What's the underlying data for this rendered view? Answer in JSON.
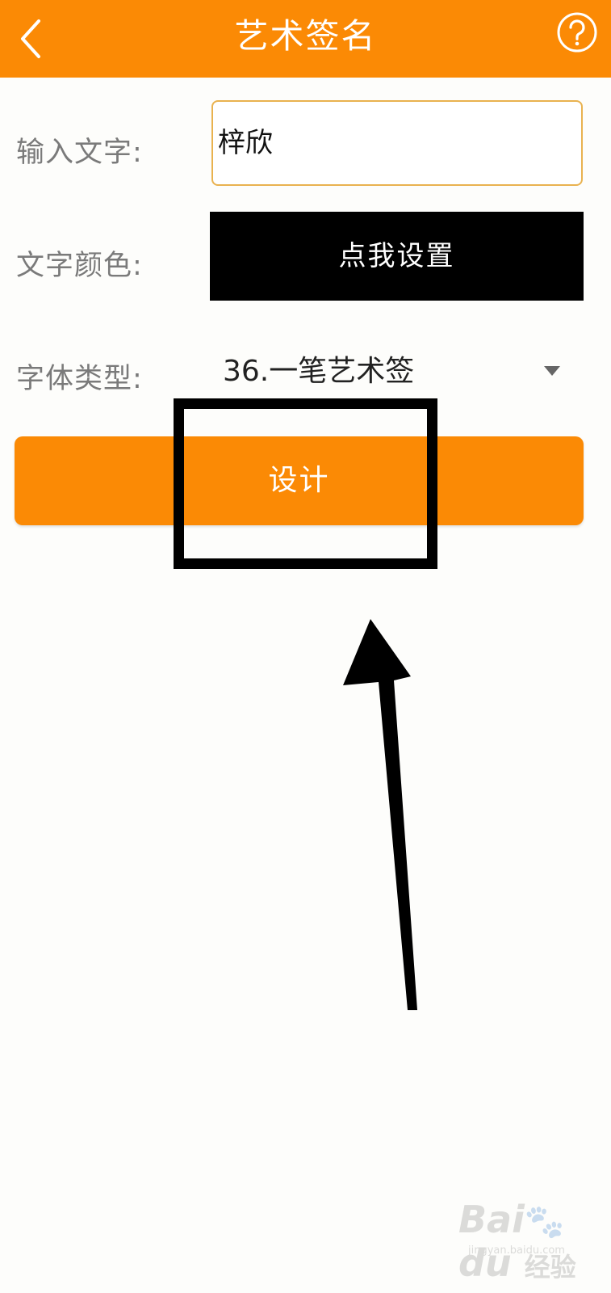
{
  "theme": {
    "accent": "#fb8a05",
    "annotation_color": "#000000"
  },
  "header": {
    "back_icon": "chevron-left-icon",
    "title": "艺术签名",
    "help_icon": "question-circle-icon"
  },
  "form": {
    "text_label": "输入文字:",
    "text_value": "梓欣",
    "color_label": "文字颜色:",
    "color_button_label": "点我设置",
    "color_button_bg": "#000000",
    "font_label": "字体类型:",
    "font_selected": "36.一笔艺术签"
  },
  "design_button_label": "设计",
  "watermark": {
    "logo": "Bai du 经验",
    "sub": "jingyan.baidu.com"
  }
}
